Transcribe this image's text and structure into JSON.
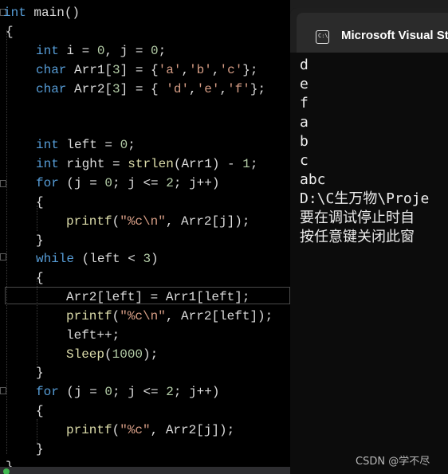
{
  "editor": {
    "lines": [
      {
        "tokens": [
          {
            "t": "int",
            "c": "kw"
          },
          {
            "t": " main()",
            "c": ""
          }
        ]
      },
      {
        "tokens": [
          {
            "t": "{",
            "c": ""
          }
        ]
      },
      {
        "tokens": [
          {
            "t": "int",
            "c": "kw"
          },
          {
            "t": " i = ",
            "c": ""
          },
          {
            "t": "0",
            "c": "num"
          },
          {
            "t": ", j = ",
            "c": ""
          },
          {
            "t": "0",
            "c": "num"
          },
          {
            "t": ";",
            "c": ""
          }
        ]
      },
      {
        "tokens": [
          {
            "t": "char",
            "c": "kw"
          },
          {
            "t": " Arr1[",
            "c": ""
          },
          {
            "t": "3",
            "c": "num"
          },
          {
            "t": "] = {",
            "c": ""
          },
          {
            "t": "'a'",
            "c": "str"
          },
          {
            "t": ",",
            "c": ""
          },
          {
            "t": "'b'",
            "c": "str"
          },
          {
            "t": ",",
            "c": ""
          },
          {
            "t": "'c'",
            "c": "str"
          },
          {
            "t": "};",
            "c": ""
          }
        ]
      },
      {
        "tokens": [
          {
            "t": "char",
            "c": "kw"
          },
          {
            "t": " Arr2[",
            "c": ""
          },
          {
            "t": "3",
            "c": "num"
          },
          {
            "t": "] = { ",
            "c": ""
          },
          {
            "t": "'d'",
            "c": "str"
          },
          {
            "t": ",",
            "c": ""
          },
          {
            "t": "'e'",
            "c": "str"
          },
          {
            "t": ",",
            "c": ""
          },
          {
            "t": "'f'",
            "c": "str"
          },
          {
            "t": "};",
            "c": ""
          }
        ]
      },
      {
        "tokens": []
      },
      {
        "tokens": []
      },
      {
        "tokens": [
          {
            "t": "int",
            "c": "kw"
          },
          {
            "t": " left = ",
            "c": ""
          },
          {
            "t": "0",
            "c": "num"
          },
          {
            "t": ";",
            "c": ""
          }
        ]
      },
      {
        "tokens": [
          {
            "t": "int",
            "c": "kw"
          },
          {
            "t": " right = ",
            "c": ""
          },
          {
            "t": "strlen",
            "c": "fn"
          },
          {
            "t": "(Arr1) - ",
            "c": ""
          },
          {
            "t": "1",
            "c": "num"
          },
          {
            "t": ";",
            "c": ""
          }
        ]
      },
      {
        "tokens": [
          {
            "t": "for",
            "c": "kw"
          },
          {
            "t": " (j = ",
            "c": ""
          },
          {
            "t": "0",
            "c": "num"
          },
          {
            "t": "; j <= ",
            "c": ""
          },
          {
            "t": "2",
            "c": "num"
          },
          {
            "t": "; j++)",
            "c": ""
          }
        ]
      },
      {
        "tokens": [
          {
            "t": "{",
            "c": ""
          }
        ]
      },
      {
        "tokens": [
          {
            "t": "printf",
            "c": "fn"
          },
          {
            "t": "(",
            "c": ""
          },
          {
            "t": "\"%c\\n\"",
            "c": "str"
          },
          {
            "t": ", Arr2[j]);",
            "c": ""
          }
        ]
      },
      {
        "tokens": [
          {
            "t": "}",
            "c": ""
          }
        ]
      },
      {
        "tokens": [
          {
            "t": "while",
            "c": "kw"
          },
          {
            "t": " (left < ",
            "c": ""
          },
          {
            "t": "3",
            "c": "num"
          },
          {
            "t": ")",
            "c": ""
          }
        ]
      },
      {
        "tokens": [
          {
            "t": "{",
            "c": ""
          }
        ]
      },
      {
        "tokens": [
          {
            "t": "Arr2[left] = Arr1[left];",
            "c": ""
          }
        ]
      },
      {
        "tokens": [
          {
            "t": "printf",
            "c": "fn"
          },
          {
            "t": "(",
            "c": ""
          },
          {
            "t": "\"%c\\n\"",
            "c": "str"
          },
          {
            "t": ", Arr2[left]);",
            "c": ""
          }
        ]
      },
      {
        "tokens": [
          {
            "t": "left++;",
            "c": ""
          }
        ]
      },
      {
        "tokens": [
          {
            "t": "Sleep",
            "c": "fn"
          },
          {
            "t": "(",
            "c": ""
          },
          {
            "t": "1000",
            "c": "num"
          },
          {
            "t": ");",
            "c": ""
          }
        ]
      },
      {
        "tokens": [
          {
            "t": "}",
            "c": ""
          }
        ]
      },
      {
        "tokens": [
          {
            "t": "for",
            "c": "kw"
          },
          {
            "t": " (j = ",
            "c": ""
          },
          {
            "t": "0",
            "c": "num"
          },
          {
            "t": "; j <= ",
            "c": ""
          },
          {
            "t": "2",
            "c": "num"
          },
          {
            "t": "; j++)",
            "c": ""
          }
        ]
      },
      {
        "tokens": [
          {
            "t": "{",
            "c": ""
          }
        ]
      },
      {
        "tokens": [
          {
            "t": "printf",
            "c": "fn"
          },
          {
            "t": "(",
            "c": ""
          },
          {
            "t": "\"%c\"",
            "c": "str"
          },
          {
            "t": ", Arr2[j]);",
            "c": ""
          }
        ]
      },
      {
        "tokens": [
          {
            "t": "}",
            "c": ""
          }
        ]
      },
      {
        "tokens": [
          {
            "t": "}",
            "c": ""
          }
        ]
      }
    ]
  },
  "console": {
    "title": "Microsoft Visual Studio",
    "icon": "console-icon",
    "icon_glyph": "C:\\",
    "output": [
      "d",
      "e",
      "f",
      "a",
      "b",
      "c",
      "abc",
      "D:\\C生万物\\Proje",
      "要在调试停止时自",
      "按任意键关闭此窗"
    ]
  },
  "watermark": "CSDN @学不尽",
  "colors": {
    "keyword": "#569cd6",
    "string": "#d69d85",
    "number": "#b5cea8",
    "function": "#dcdcaa",
    "text": "#dcdcdc"
  }
}
